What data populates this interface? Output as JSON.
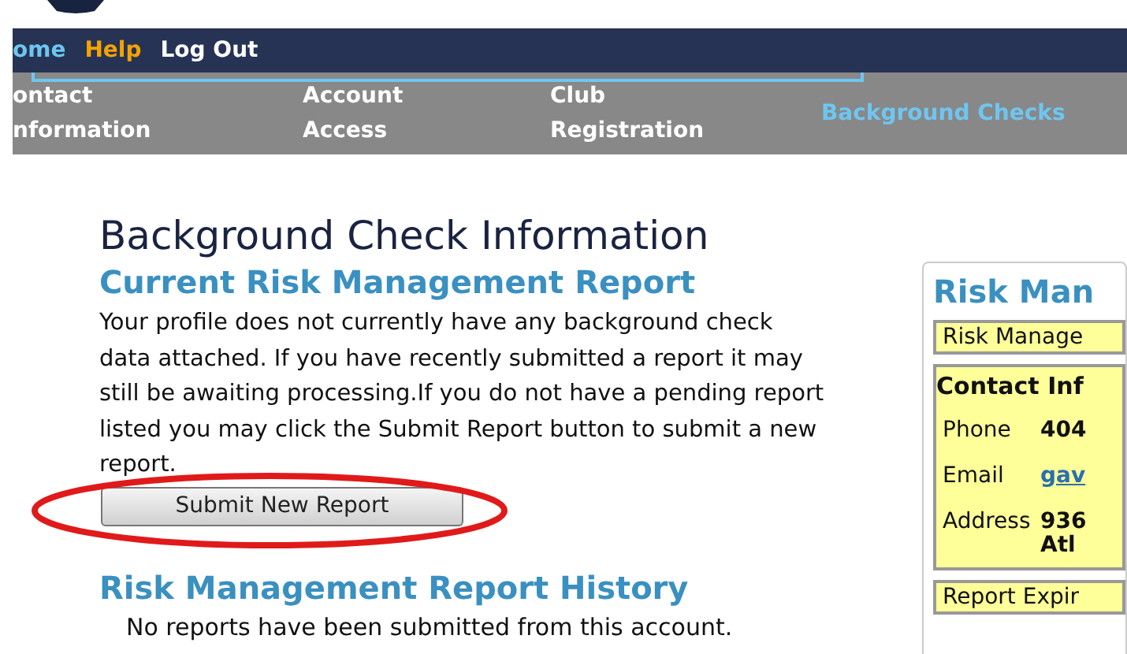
{
  "top_links": [
    {
      "label": "ome",
      "color": "#6ec6f0"
    },
    {
      "label": "Help",
      "color": "#f5a300"
    },
    {
      "label": "Log Out",
      "color": "#ffffff"
    }
  ],
  "tabs": [
    {
      "label": "ontact nformation",
      "selected": false
    },
    {
      "label": "Account Access",
      "selected": false
    },
    {
      "label": "Club Registration",
      "selected": false
    },
    {
      "label": "Background Checks",
      "selected": true
    }
  ],
  "main": {
    "title": "Background Check Information",
    "current_heading": "Current Risk Management Report",
    "message": "Your profile does not currently have any background check data attached. If you have recently submitted a report it may still be awaiting processing.If you do not have a pending report listed you may click the Submit Report button to submit a new report.",
    "submit_button": "Submit New Report",
    "button_highlighted": true,
    "history_heading": "Risk Management Report History",
    "history_empty": "No reports have been submitted from this account."
  },
  "side_panel": {
    "title": "Risk Man",
    "report_label": "Risk Manage",
    "contact": {
      "heading": "Contact Inf",
      "rows": [
        {
          "label": "Phone",
          "value": "404",
          "kind": "text"
        },
        {
          "label": "Email",
          "value": "gav",
          "kind": "link"
        },
        {
          "label": "Address",
          "value": "936",
          "kind": "text"
        },
        {
          "label": "",
          "value": "Atl",
          "kind": "text"
        }
      ]
    },
    "expiry_label": "Report Expir"
  }
}
